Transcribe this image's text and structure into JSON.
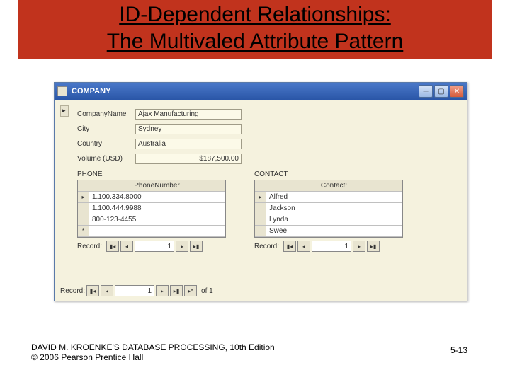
{
  "title_line1_part1": "ID-Dependent Relationships:",
  "title_line2_part1": "The Multivaled Attribute Pattern",
  "window": {
    "title": "COMPANY",
    "fields": {
      "company_label": "CompanyName",
      "company_value": "Ajax Manufacturing",
      "city_label": "City",
      "city_value": "Sydney",
      "country_label": "Country",
      "country_value": "Australia",
      "volume_label": "Volume (USD)",
      "volume_value": "$187,500.00"
    },
    "phone": {
      "label": "PHONE",
      "header": "PhoneNumber",
      "rows": [
        "1.100.334.8000",
        "1.100.444.9988",
        "800-123-4455"
      ],
      "rec_label": "Record:",
      "rec_val": "1"
    },
    "contact": {
      "label": "CONTACT",
      "header": "Contact:",
      "rows": [
        "Alfred",
        "Jackson",
        "Lynda",
        "Swee"
      ],
      "rec_label": "Record:",
      "rec_val": "1"
    },
    "mainnav": {
      "label": "Record:",
      "val": "1",
      "of": "of 1"
    }
  },
  "footer": {
    "line1": "DAVID M. KROENKE'S DATABASE PROCESSING, 10th Edition",
    "line2": "© 2006 Pearson Prentice Hall"
  },
  "pagenum": "5-13",
  "nav_icons": {
    "first": "▮◂",
    "prev": "◂",
    "next": "▸",
    "last": "▸▮",
    "new": "▸*"
  }
}
